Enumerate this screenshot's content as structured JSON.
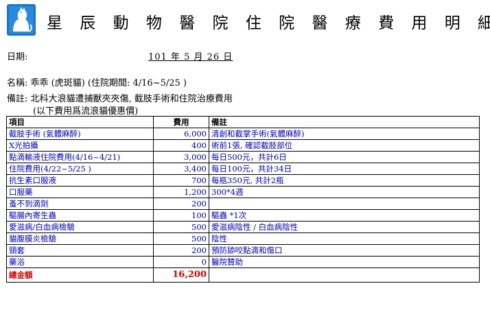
{
  "header": {
    "title": "星 辰 動 物 醫 院 住 院 醫 療 費 用 明 細",
    "logo_icon": "cat-silhouette-logo-icon"
  },
  "date": {
    "label": "日期:",
    "value": "101  年  5  月 26  日"
  },
  "name_line": "名稱: 乖乖 (虎斑貓) (住院期間: 4/16~5/25    )",
  "note_line1": "備註: 北科大浪貓遭捕獸夾夾傷, 截肢手術和住院治療費用",
  "note_line2": "(以下費用爲流浪貓優惠價)",
  "table": {
    "headers": [
      "項目",
      "費用",
      "備註"
    ],
    "rows": [
      {
        "item": "截肢手術 (氣體麻醉)",
        "cost": "6,000",
        "note": "清創和截掌手術(氣體麻醉)"
      },
      {
        "item": "X光拍攝",
        "cost": "400",
        "note": "術前1張, 確認截肢部位"
      },
      {
        "item": "點滴輸液住院費用(4/16~4/21)",
        "cost": "3,000",
        "note": "每日500元，共計6日"
      },
      {
        "item": "住院費用(4/22~5/25 )",
        "cost": "3,400",
        "note": "每日100元，共計34日"
      },
      {
        "item": "抗生素口服液",
        "cost": "700",
        "note": "每瓶350元, 共計2瓶"
      },
      {
        "item": "口服藥",
        "cost": "1,200",
        "note": "300*4週"
      },
      {
        "item": "蚤不到滴劑",
        "cost": "200",
        "note": ""
      },
      {
        "item": "驅腸內寄生蟲",
        "cost": "100",
        "note": "驅蟲 *1次"
      },
      {
        "item": "愛滋病/白血病檢驗",
        "cost": "500",
        "note": "愛滋病陰性 / 白血病陰性"
      },
      {
        "item": "貓腹膜炎檢驗",
        "cost": "500",
        "note": "陰性"
      },
      {
        "item": "頸套",
        "cost": "200",
        "note": "預防舔咬點滴和傷口"
      },
      {
        "item": "藥浴",
        "cost": "0",
        "note": "醫院贊助"
      }
    ],
    "total": {
      "label": "總金額",
      "value": "16,200"
    }
  },
  "colors": {
    "row_text": "#0000cc",
    "total_text": "#e00000",
    "logo_bg": "#1976c8"
  }
}
